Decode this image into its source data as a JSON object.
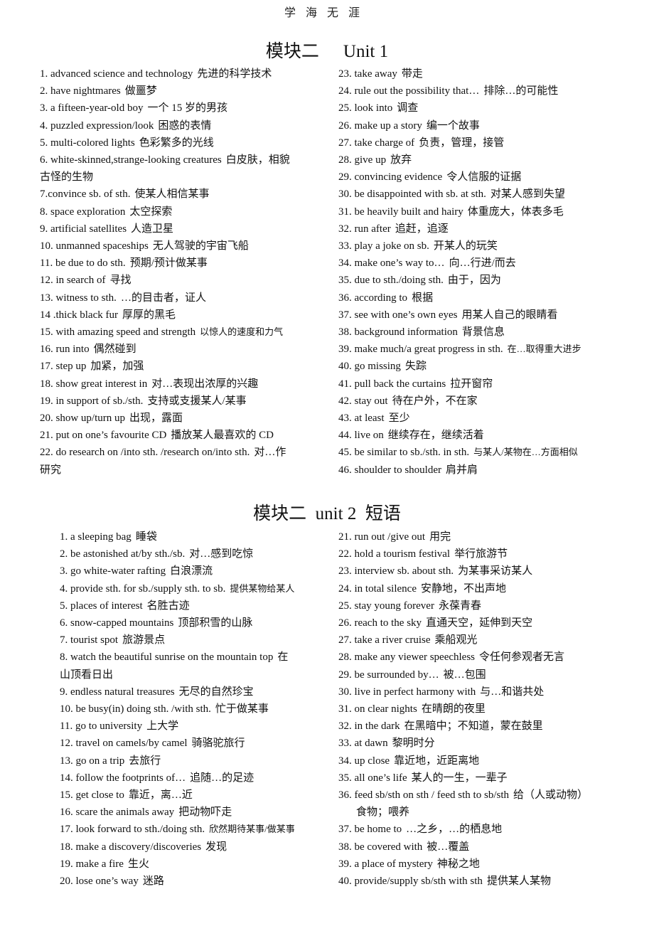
{
  "header": {
    "text": "学海无涯"
  },
  "sections": [
    {
      "title_cn": "模块二",
      "title_en": "Unit 1",
      "left": [
        {
          "en": "1. advanced science and technology",
          "cn": "先进的科学技术"
        },
        {
          "en": "2. have nightmares",
          "cn": "做噩梦"
        },
        {
          "en": "3. a fifteen-year-old boy",
          "cn": "一个 15 岁的男孩"
        },
        {
          "en": "4. puzzled expression/look",
          "cn": "困惑的表情"
        },
        {
          "en": "5. multi-colored lights",
          "cn": "色彩繁多的光线"
        },
        {
          "en": "6. white-skinned,strange-looking creatures",
          "cn": "白皮肤，相貌",
          "cont": "古怪的生物"
        },
        {
          "en": "7.convince sb. of sth.",
          "cn": "使某人相信某事"
        },
        {
          "en": "8. space exploration",
          "cn": "太空探索"
        },
        {
          "en": "9. artificial satellites",
          "cn": "人造卫星"
        },
        {
          "en": "10. unmanned spaceships",
          "cn": "无人驾驶的宇宙飞船"
        },
        {
          "en": "11. be due to do sth.",
          "cn": "预期/预计做某事"
        },
        {
          "en": "12. in search of",
          "cn": "寻找"
        },
        {
          "en": "13. witness to sth.",
          "cn": "…的目击者，证人"
        },
        {
          "en": "14 .thick black fur",
          "cn": "厚厚的黑毛"
        },
        {
          "en": "15. with amazing speed and strength",
          "cn": "以惊人的速度和力气",
          "small": true
        },
        {
          "en": "16. run into",
          "cn": "偶然碰到"
        },
        {
          "en": "17. step up",
          "cn": "加紧，加强"
        },
        {
          "en": "18. show great interest in",
          "cn": "对…表现出浓厚的兴趣"
        },
        {
          "en": "19. in support of sb./sth.",
          "cn": "支持或支援某人/某事"
        },
        {
          "en": "20. show up/turn up",
          "cn": "出现，露面"
        },
        {
          "en": "21. put on one’s favourite CD",
          "cn": "播放某人最喜欢的 CD"
        },
        {
          "en": "22. do research on /into sth. /research on/into sth.",
          "cn": "对…作",
          "cont": "研究"
        }
      ],
      "right": [
        {
          "en": "23. take away",
          "cn": "带走"
        },
        {
          "en": "24. rule out the possibility that…",
          "cn": "排除…的可能性"
        },
        {
          "en": "25. look into",
          "cn": "调查"
        },
        {
          "en": "26. make up a story",
          "cn": "编一个故事"
        },
        {
          "en": "27. take charge of",
          "cn": "负责，管理，接管"
        },
        {
          "en": "28. give up",
          "cn": "放弃"
        },
        {
          "en": "29. convincing evidence",
          "cn": "令人信服的证据"
        },
        {
          "en": "30. be disappointed with sb. at sth.",
          "cn": "对某人感到失望"
        },
        {
          "en": "31. be heavily built and hairy",
          "cn": "体重庞大，体表多毛"
        },
        {
          "en": "32. run after",
          "cn": "追赶，追逐"
        },
        {
          "en": "33. play a joke on sb.",
          "cn": "开某人的玩笑"
        },
        {
          "en": "34. make one’s way to…",
          "cn": "向…行进/而去"
        },
        {
          "en": "35. due to sth./doing sth.",
          "cn": "由于，因为"
        },
        {
          "en": "36. according to",
          "cn": "根据"
        },
        {
          "en": "37. see with one’s own eyes",
          "cn": "用某人自己的眼睛看"
        },
        {
          "en": "38. background information",
          "cn": "背景信息"
        },
        {
          "en": "39. make much/a great progress in sth.",
          "cn": "在…取得重大进步",
          "small": true
        },
        {
          "en": "40. go missing",
          "cn": "失踪"
        },
        {
          "en": "41. pull back the curtains",
          "cn": "拉开窗帘"
        },
        {
          "en": "42. stay out",
          "cn": "待在户外，不在家"
        },
        {
          "en": "43. at least",
          "cn": "至少"
        },
        {
          "en": "44. live on",
          "cn": "继续存在，继续活着"
        },
        {
          "en": "45. be similar to sb./sth. in sth.",
          "cn": "与某人/某物在…方面相似",
          "small": true
        },
        {
          "en": "46. shoulder to shoulder",
          "cn": "肩并肩"
        }
      ]
    },
    {
      "title_cn": "模块二",
      "title_en": "unit 2",
      "title_suffix": "短语",
      "left": [
        {
          "en": "1. a sleeping bag",
          "cn": "睡袋"
        },
        {
          "en": "2. be astonished at/by sth./sb.",
          "cn": "对…感到吃惊"
        },
        {
          "en": "3. go white-water rafting",
          "cn": "白浪漂流"
        },
        {
          "en": "4. provide sth. for sb./supply sth. to sb.",
          "cn": "提供某物给某人",
          "small": true
        },
        {
          "en": "5. places of interest",
          "cn": "名胜古迹"
        },
        {
          "en": "6. snow-capped mountains",
          "cn": "顶部积雪的山脉"
        },
        {
          "en": "7. tourist spot",
          "cn": "旅游景点"
        },
        {
          "en": "8. watch the beautiful sunrise on the mountain top",
          "cn": "在",
          "cont": "山顶看日出"
        },
        {
          "en": "9. endless natural treasures",
          "cn": "无尽的自然珍宝"
        },
        {
          "en": "10. be busy(in) doing sth. /with sth.",
          "cn": "忙于做某事"
        },
        {
          "en": "11. go to university",
          "cn": "上大学"
        },
        {
          "en": "12. travel on camels/by camel",
          "cn": "骑骆驼旅行"
        },
        {
          "en": "13. go on a trip",
          "cn": "去旅行"
        },
        {
          "en": "14. follow the footprints of…",
          "cn": "追随…的足迹"
        },
        {
          "en": "15. get close to",
          "cn": "靠近，离…近"
        },
        {
          "en": "16. scare the animals away",
          "cn": "把动物吓走"
        },
        {
          "en": "17. look forward to sth./doing sth.",
          "cn": "欣然期待某事/做某事",
          "small": true
        },
        {
          "en": "18. make a discovery/discoveries",
          "cn": "发现"
        },
        {
          "en": "19. make a fire",
          "cn": "生火"
        },
        {
          "en": "20. lose one’s way",
          "cn": "迷路"
        }
      ],
      "right": [
        {
          "en": "21. run out /give out",
          "cn": "用完"
        },
        {
          "en": "22. hold a tourism festival",
          "cn": "举行旅游节"
        },
        {
          "en": "23. interview sb. about sth.",
          "cn": "为某事采访某人"
        },
        {
          "en": "24. in total silence",
          "cn": "安静地，不出声地"
        },
        {
          "en": "25. stay young forever",
          "cn": "永葆青春"
        },
        {
          "en": "26. reach to the sky",
          "cn": "直通天空，延伸到天空"
        },
        {
          "en": "27. take a river cruise",
          "cn": "乘船观光"
        },
        {
          "en": "28. make any viewer speechless",
          "cn": "令任何参观者无言"
        },
        {
          "en": "29. be surrounded by…",
          "cn": "被…包围"
        },
        {
          "en": "30. live in perfect harmony with",
          "cn": "与…和谐共处"
        },
        {
          "en": "31. on clear nights",
          "cn": "在晴朗的夜里"
        },
        {
          "en": "32. in the dark",
          "cn": "在黑暗中；不知道，蒙在鼓里"
        },
        {
          "en": "33. at dawn",
          "cn": "黎明时分"
        },
        {
          "en": "34. up close",
          "cn": "靠近地，近距离地"
        },
        {
          "en": "35. all one’s life",
          "cn": "某人的一生，一辈子"
        },
        {
          "en": "36. feed sb/sth on sth / feed sth to sb/sth",
          "cn": "给（人或动物）",
          "cont": "食物；喂养",
          "indent": true
        },
        {
          "en": "37. be home to",
          "cn": "…之乡，…的栖息地"
        },
        {
          "en": "38. be covered with",
          "cn": "被…覆盖"
        },
        {
          "en": "39. a place of mystery",
          "cn": "神秘之地"
        },
        {
          "en": "40. provide/supply sb/sth with sth",
          "cn": "提供某人某物"
        }
      ]
    }
  ]
}
